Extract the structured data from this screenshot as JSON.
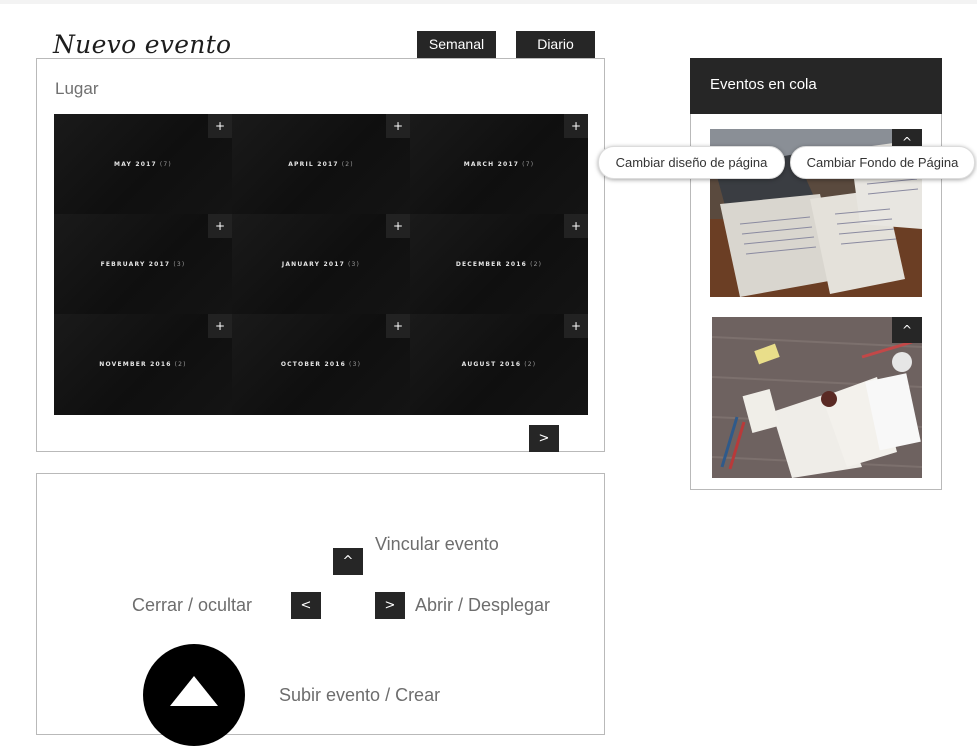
{
  "page": {
    "title": "Nuevo evento"
  },
  "view_buttons": {
    "weekly": "Semanal",
    "daily": "Diario"
  },
  "lugar": {
    "label": "Lugar",
    "archive": [
      {
        "month": "MAY 2017",
        "count": "(7)"
      },
      {
        "month": "APRIL 2017",
        "count": "(2)"
      },
      {
        "month": "MARCH 2017",
        "count": "(7)"
      },
      {
        "month": "FEBRUARY 2017",
        "count": "(3)"
      },
      {
        "month": "JANUARY 2017",
        "count": "(3)"
      },
      {
        "month": "DECEMBER 2016",
        "count": "(2)"
      },
      {
        "month": "NOVEMBER 2016",
        "count": "(2)"
      },
      {
        "month": "OCTOBER 2016",
        "count": "(3)"
      },
      {
        "month": "AUGUST 2016",
        "count": "(2)"
      }
    ],
    "plus_glyph": "+",
    "next_glyph": ">"
  },
  "controls": {
    "link_label": "Vincular evento",
    "link_glyph": "^",
    "close_label": "Cerrar / ocultar",
    "close_glyph": "<",
    "open_label": "Abrir / Desplegar",
    "open_glyph": ">",
    "upload_label": "Subir evento / Crear"
  },
  "queue": {
    "title": "Eventos en cola",
    "caret_glyph": "^"
  },
  "floating_buttons": {
    "change_layout": "Cambiar diseño de página",
    "change_background": "Cambiar Fondo de Página"
  },
  "colors": {
    "dark": "#262626",
    "border": "#b9b9b9"
  }
}
